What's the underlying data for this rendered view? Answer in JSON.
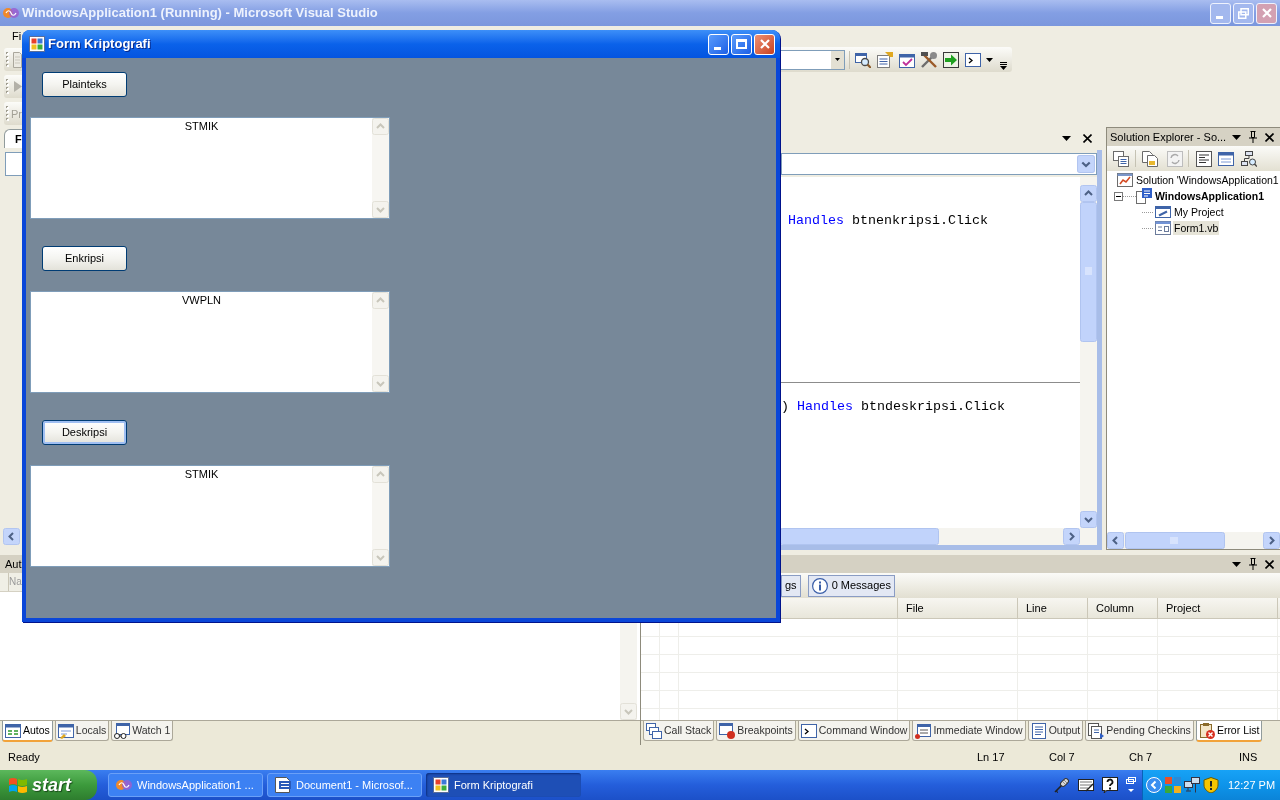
{
  "vs_window": {
    "title": "WindowsApplication1 (Running) - Microsoft Visual Studio",
    "menu_bar": [
      "Fi"
    ],
    "toolbar_text": "Pr",
    "left_panel": {
      "tab": {
        "label": "F",
        "selected": true
      }
    },
    "editor": {
      "code_blocks": [
        {
          "lines": [
            {
              "segments": [
                {
                  "kind": "keyword",
                  "text": "Handles"
                },
                {
                  "kind": "plain",
                  "text": " btnenkripsi.Click"
                }
              ]
            }
          ]
        },
        {
          "lines": [
            {
              "segments": [
                {
                  "kind": "plain",
                  "text": ") "
                },
                {
                  "kind": "keyword",
                  "text": "Handles"
                },
                {
                  "kind": "plain",
                  "text": " btndeskripsi.Click"
                }
              ]
            }
          ]
        }
      ]
    },
    "solution_explorer": {
      "title": "Solution Explorer - So...",
      "tree": [
        {
          "label": "Solution 'WindowsApplication1",
          "kind": "solution",
          "selected": false,
          "children": [
            {
              "label": "WindowsApplication1",
              "kind": "project",
              "selected": false,
              "expanded": true,
              "children": [
                {
                  "label": "My Project",
                  "kind": "properties",
                  "selected": false
                },
                {
                  "label": "Form1.vb",
                  "kind": "form",
                  "selected": true
                }
              ]
            }
          ]
        }
      ]
    },
    "autos_panel": {
      "title": "Aut",
      "columns": [
        "Na"
      ],
      "tabs": [
        {
          "label": "Autos",
          "kind": "autos",
          "selected": true
        },
        {
          "label": "Locals",
          "kind": "locals",
          "selected": false
        },
        {
          "label": "Watch 1",
          "kind": "watch",
          "selected": false
        }
      ]
    },
    "error_list": {
      "filters": [
        {
          "label": "gs",
          "kind": "warnings",
          "on": true
        },
        {
          "label": "0 Messages",
          "kind": "messages",
          "on": true
        }
      ],
      "columns": [
        "File",
        "Line",
        "Column",
        "Project"
      ],
      "tabs": [
        {
          "label": "Call Stack",
          "kind": "call-stack",
          "selected": false
        },
        {
          "label": "Breakpoints",
          "kind": "breakpoints",
          "selected": false
        },
        {
          "label": "Command Window",
          "kind": "command",
          "selected": false
        },
        {
          "label": "Immediate Window",
          "kind": "immediate",
          "selected": false
        },
        {
          "label": "Output",
          "kind": "output",
          "selected": false
        },
        {
          "label": "Pending Checkins",
          "kind": "checkins",
          "selected": false
        },
        {
          "label": "Error List",
          "kind": "errors",
          "selected": true
        }
      ]
    },
    "status_bar": {
      "message": "Ready",
      "fields": [
        "Ln 17",
        "Col 7",
        "Ch 7",
        "INS"
      ]
    }
  },
  "form": {
    "title": "Form Kriptografi",
    "sections": [
      {
        "button": {
          "label": "Plainteks",
          "focused": false
        },
        "textbox": {
          "value": "STMIK"
        }
      },
      {
        "button": {
          "label": "Enkripsi",
          "focused": false
        },
        "textbox": {
          "value": "VWPLN"
        }
      },
      {
        "button": {
          "label": "Deskripsi",
          "focused": true
        },
        "textbox": {
          "value": "STMIK"
        }
      }
    ]
  },
  "taskbar": {
    "start_label": "start",
    "tasks": [
      {
        "label": "WindowsApplication1 ...",
        "kind": "visual-studio",
        "selected": false
      },
      {
        "label": "Document1 - Microsof...",
        "kind": "word",
        "selected": false
      },
      {
        "label": "Form Kriptografi",
        "kind": "form",
        "selected": true
      }
    ],
    "clock": "12:27 PM"
  }
}
